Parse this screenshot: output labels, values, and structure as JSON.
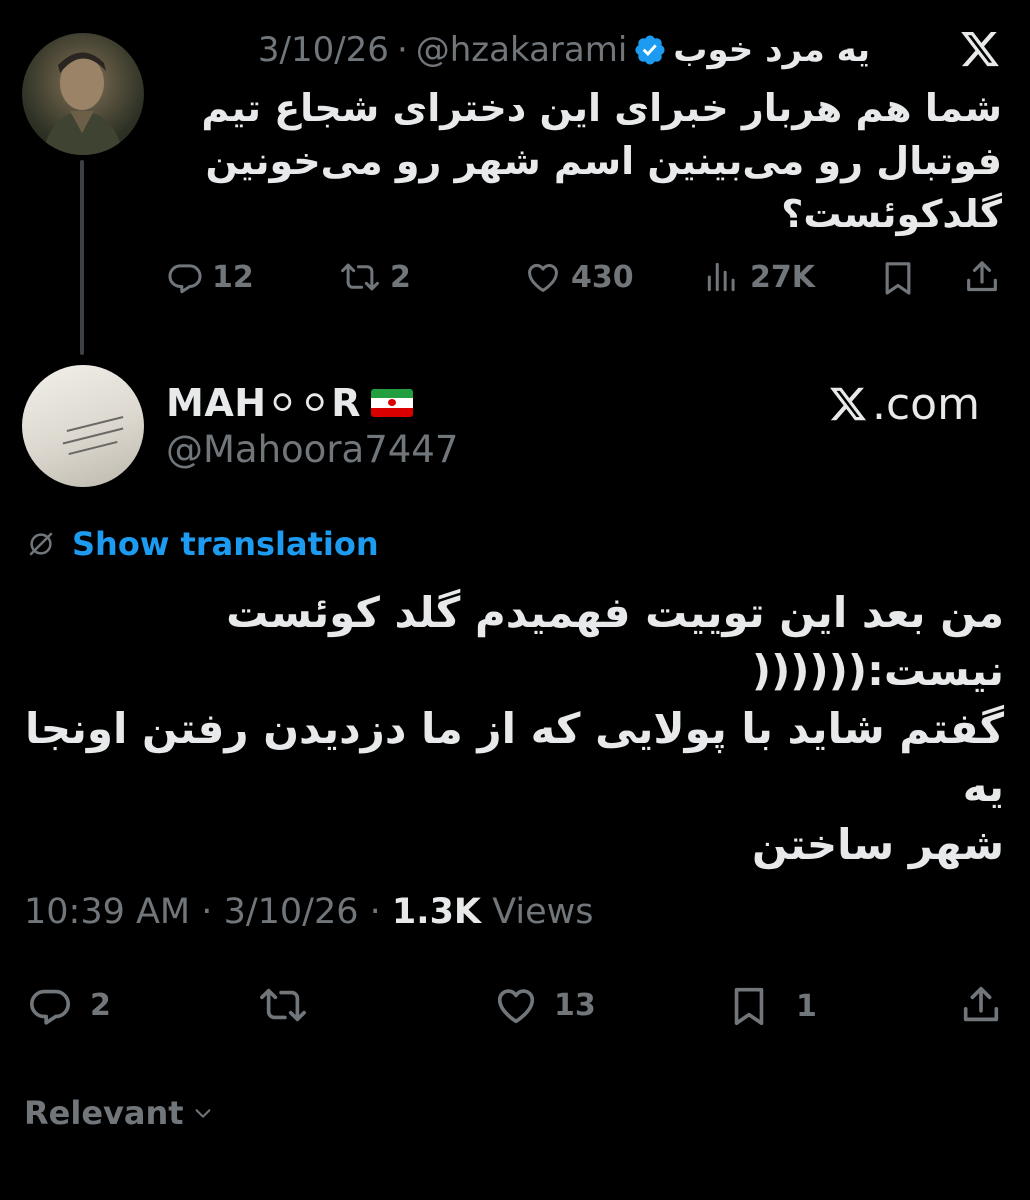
{
  "parent_tweet": {
    "display_name": "یه مرد خوب",
    "handle": "@hzakarami",
    "separator": "·",
    "date": "3/10/26",
    "text_lines": [
      "شما هم هربار خبرای این دخترای شجاع تیم",
      "فوتبال رو می‌بینین اسم شهر رو می‌خونین",
      "گلدکوئست؟"
    ],
    "actions": {
      "replies": "12",
      "reposts": "2",
      "likes": "430",
      "views": "27K"
    }
  },
  "reply_tweet": {
    "display_name": "MAH⚪⚪R",
    "handle": "@Mahoora7447",
    "source_label": ".com",
    "translate_label": "Show translation",
    "text_lines": [
      "من بعد این توییت فهمیدم گلد کوئست",
      "نیست:((((((",
      "گفتم شاید با پولایی که از ما دزدیدن رفتن اونجا یه",
      "شهر ساختن"
    ],
    "meta": {
      "time": "10:39 AM",
      "separator": "·",
      "date": "3/10/26",
      "views_count": "1.3K",
      "views_label": "Views"
    },
    "actions": {
      "replies": "2",
      "likes": "13",
      "bookmarks": "1"
    }
  },
  "footer": {
    "sort_label": "Relevant"
  },
  "colors": {
    "background": "#000000",
    "text_primary": "#e7e9ea",
    "text_secondary": "#71767b",
    "accent": "#1d9bf0",
    "thread_line": "#3d4044"
  }
}
